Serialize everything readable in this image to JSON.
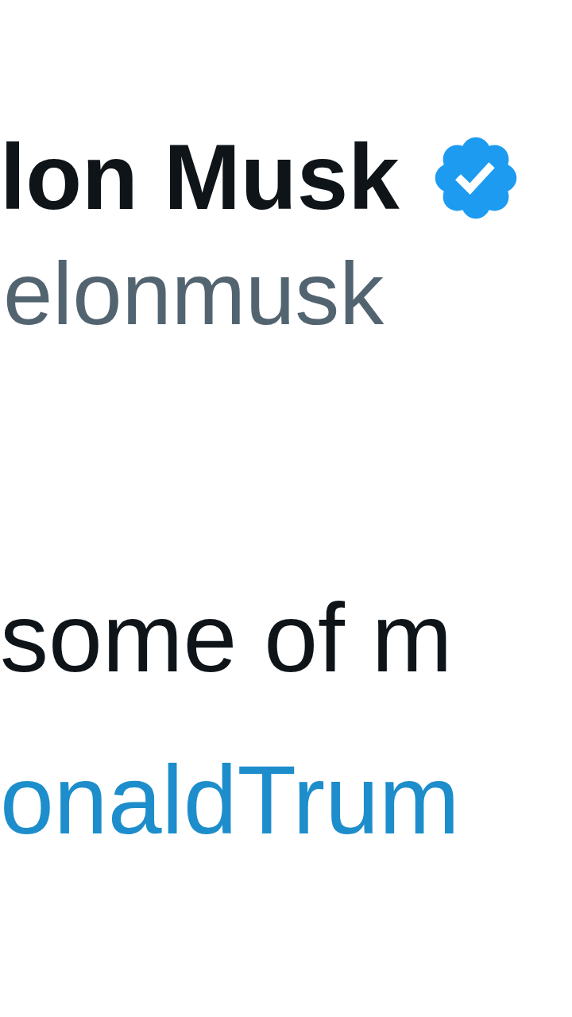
{
  "author": {
    "name": "lon Musk",
    "verified": true,
    "handle": "elonmusk"
  },
  "body": {
    "text": "some of m",
    "link": "onaldTrum"
  }
}
